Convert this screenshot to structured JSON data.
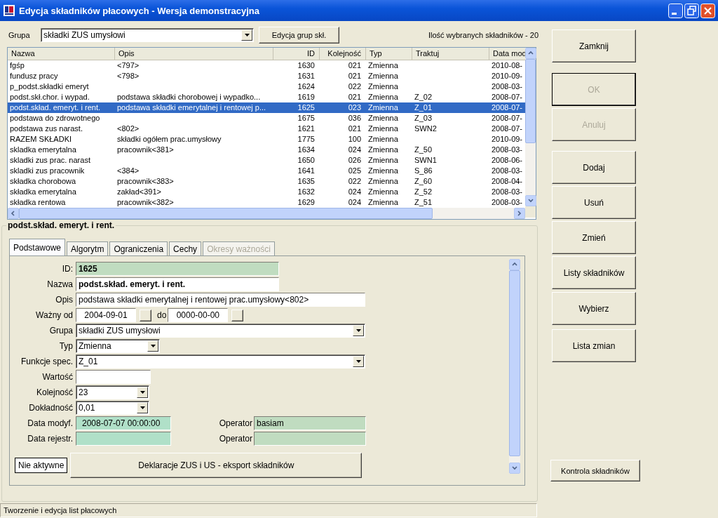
{
  "window": {
    "title": "Edycja składników płacowych - Wersja demonstracyjna"
  },
  "filter": {
    "label": "Grupa",
    "value": "składki ZUS umysłowi",
    "button": "Edycja grup skł.",
    "count": "Ilość wybranych składników - 20"
  },
  "table": {
    "columns": [
      "Nazwa",
      "Opis",
      "ID",
      "Kolejność",
      "Typ",
      "Traktuj",
      "Data mod"
    ],
    "rows": [
      {
        "cells": [
          "fgśp",
          "<797>",
          "1630",
          "021",
          "Zmienna",
          "",
          "2010-08-"
        ],
        "selected": false
      },
      {
        "cells": [
          "fundusz pracy",
          "<798>",
          "1631",
          "021",
          "Zmienna",
          "",
          "2010-09-"
        ],
        "selected": false
      },
      {
        "cells": [
          "p_podst.składki emeryt",
          "",
          "1624",
          "022",
          "Zmienna",
          "",
          "2008-03-"
        ],
        "selected": false
      },
      {
        "cells": [
          "podst.skł.chor. i wypad.",
          "podstawa składki chorobowej i wypadko...",
          "1619",
          "021",
          "Zmienna",
          "Z_02",
          "2008-07-"
        ],
        "selected": false
      },
      {
        "cells": [
          "podst.skład. emeryt. i rent.",
          "podstawa składki emerytalnej i rentowej p...",
          "1625",
          "023",
          "Zmienna",
          "Z_01",
          "2008-07-"
        ],
        "selected": true
      },
      {
        "cells": [
          "podstawa do zdrowotnego",
          "",
          "1675",
          "036",
          "Zmienna",
          "Z_03",
          "2008-07-"
        ],
        "selected": false
      },
      {
        "cells": [
          "podstawa zus narast.",
          "<802>",
          "1621",
          "021",
          "Zmienna",
          "SWN2",
          "2008-07-"
        ],
        "selected": false
      },
      {
        "cells": [
          "RAZEM SKŁADKI",
          "składki ogółem prac.umysłowy",
          "1775",
          "100",
          "Zmienna",
          "",
          "2010-09-"
        ],
        "selected": false
      },
      {
        "cells": [
          "skladka emerytalna",
          "pracownik<381>",
          "1634",
          "024",
          "Zmienna",
          "Z_50",
          "2008-03-"
        ],
        "selected": false
      },
      {
        "cells": [
          "skladki zus prac. narast",
          "",
          "1650",
          "026",
          "Zmienna",
          "SWN1",
          "2008-06-"
        ],
        "selected": false
      },
      {
        "cells": [
          "skladki zus pracownik",
          "<384>",
          "1641",
          "025",
          "Zmienna",
          "S_86",
          "2008-03-"
        ],
        "selected": false
      },
      {
        "cells": [
          "składka chorobowa",
          "pracownik<383>",
          "1635",
          "022",
          "Zmienna",
          "Z_60",
          "2008-04-"
        ],
        "selected": false
      },
      {
        "cells": [
          "składka emerytalna",
          "zakład<391>",
          "1632",
          "024",
          "Zmienna",
          "Z_52",
          "2008-03-"
        ],
        "selected": false
      },
      {
        "cells": [
          "składka rentowa",
          "pracownik<382>",
          "1629",
          "024",
          "Zmienna",
          "Z_51",
          "2008-03-"
        ],
        "selected": false
      }
    ]
  },
  "detail": {
    "title": "podst.skład. emeryt. i rent.",
    "tabs": [
      {
        "label": "Podstawowe",
        "selected": true,
        "disabled": false
      },
      {
        "label": "Algorytm",
        "selected": false,
        "disabled": false
      },
      {
        "label": "Ograniczenia",
        "selected": false,
        "disabled": false
      },
      {
        "label": "Cechy",
        "selected": false,
        "disabled": false
      },
      {
        "label": "Okresy ważności",
        "selected": false,
        "disabled": true
      }
    ],
    "rows": [
      {
        "label": "ID:",
        "kind": "text",
        "value": "1625",
        "readonly": true,
        "bold": true
      },
      {
        "label": "Nazwa",
        "kind": "text",
        "value": "podst.skład. emeryt. i rent.",
        "readonly": false,
        "bold": true
      },
      {
        "label": "Opis",
        "kind": "text",
        "value": "podstawa składki emerytalnej i rentowej prac.umysłowy<802>",
        "readonly": false,
        "bold": false
      },
      {
        "label": "Ważny od",
        "kind": "daterange",
        "from": "2004-09-01",
        "to_label": "do",
        "to": "0000-00-00"
      },
      {
        "label": "Grupa",
        "kind": "select",
        "value": "składki ZUS umysłowi"
      },
      {
        "label": "Typ",
        "kind": "select",
        "value": "Zmienna"
      },
      {
        "label": "Funkcje spec.",
        "kind": "select",
        "value": "Z_01"
      },
      {
        "label": "Wartość",
        "kind": "text",
        "readonly": false
      },
      {
        "label": "Kolejność",
        "kind": "select",
        "value": "23"
      },
      {
        "label": "Dokładność",
        "kind": "select",
        "value": "0,01"
      },
      {
        "label": "Data modyf.",
        "kind": "text",
        "value": "2008-07-07 00:00:00",
        "readonly": true,
        "bold": false,
        "operator": {
          "label": "Operator",
          "value": "basiam"
        }
      },
      {
        "label": "Data rejestr.",
        "kind": "text",
        "readonly": true,
        "operator": {
          "label": "Operator"
        }
      }
    ],
    "state_label": "Nie aktywne",
    "export_button": "Deklaracje ZUS i US - eksport składników"
  },
  "actions": [
    {
      "label": "Zamknij",
      "disabled": false,
      "default": false
    },
    {
      "label": "OK",
      "disabled": true,
      "default": true
    },
    {
      "label": "Anuluj",
      "disabled": true,
      "default": false
    },
    {
      "label": "Dodaj",
      "disabled": false,
      "default": false
    },
    {
      "label": "Usuń",
      "disabled": false,
      "default": false
    },
    {
      "label": "Zmień",
      "disabled": false,
      "default": false
    },
    {
      "label": "Listy składników",
      "disabled": false,
      "default": false
    },
    {
      "label": "Wybierz",
      "disabled": false,
      "default": false
    },
    {
      "label": "Lista zmian",
      "disabled": false,
      "default": false
    }
  ],
  "check_button": "Kontrola składników",
  "status_bar": "Tworzenie i edycja list płacowych"
}
